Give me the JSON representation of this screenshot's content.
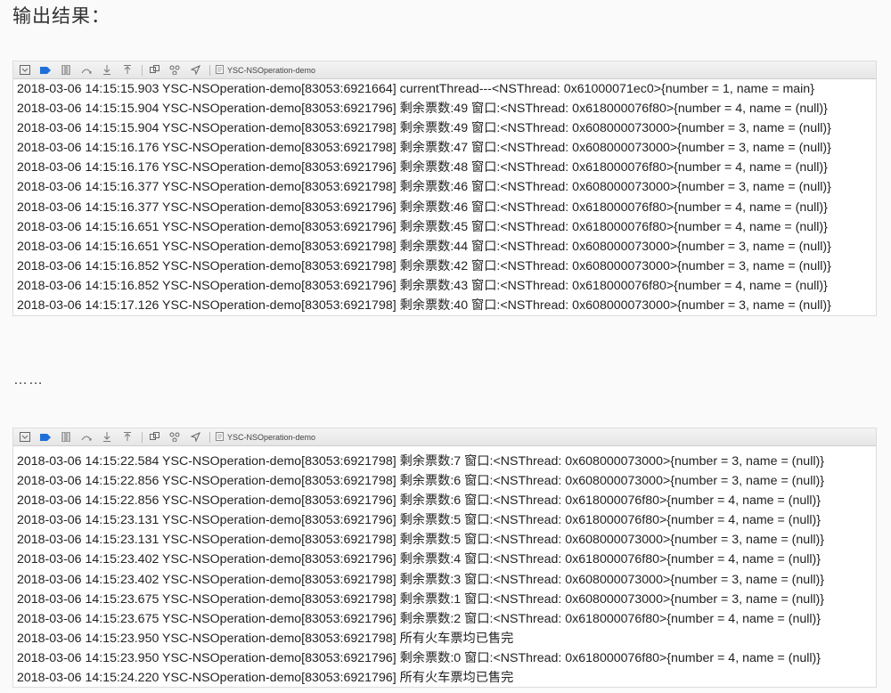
{
  "page": {
    "heading": "输出结果：",
    "ellipsis": "……"
  },
  "panels": [
    {
      "filename": "YSC-NSOperation-demo",
      "lines": [
        "2018-03-06 14:15:15.903 YSC-NSOperation-demo[83053:6921664] currentThread---<NSThread: 0x61000071ec0>{number = 1, name = main}",
        "2018-03-06 14:15:15.904 YSC-NSOperation-demo[83053:6921796] 剩余票数:49 窗口:<NSThread: 0x618000076f80>{number = 4, name = (null)}",
        "2018-03-06 14:15:15.904 YSC-NSOperation-demo[83053:6921798] 剩余票数:49 窗口:<NSThread: 0x608000073000>{number = 3, name = (null)}",
        "2018-03-06 14:15:16.176 YSC-NSOperation-demo[83053:6921798] 剩余票数:47 窗口:<NSThread: 0x608000073000>{number = 3, name = (null)}",
        "2018-03-06 14:15:16.176 YSC-NSOperation-demo[83053:6921796] 剩余票数:48 窗口:<NSThread: 0x618000076f80>{number = 4, name = (null)}",
        "2018-03-06 14:15:16.377 YSC-NSOperation-demo[83053:6921798] 剩余票数:46 窗口:<NSThread: 0x608000073000>{number = 3, name = (null)}",
        "2018-03-06 14:15:16.377 YSC-NSOperation-demo[83053:6921796] 剩余票数:46 窗口:<NSThread: 0x618000076f80>{number = 4, name = (null)}",
        "2018-03-06 14:15:16.651 YSC-NSOperation-demo[83053:6921796] 剩余票数:45 窗口:<NSThread: 0x618000076f80>{number = 4, name = (null)}",
        "2018-03-06 14:15:16.651 YSC-NSOperation-demo[83053:6921798] 剩余票数:44 窗口:<NSThread: 0x608000073000>{number = 3, name = (null)}",
        "2018-03-06 14:15:16.852 YSC-NSOperation-demo[83053:6921798] 剩余票数:42 窗口:<NSThread: 0x608000073000>{number = 3, name = (null)}",
        "2018-03-06 14:15:16.852 YSC-NSOperation-demo[83053:6921796] 剩余票数:43 窗口:<NSThread: 0x618000076f80>{number = 4, name = (null)}",
        "2018-03-06 14:15:17.126 YSC-NSOperation-demo[83053:6921798] 剩余票数:40 窗口:<NSThread: 0x608000073000>{number = 3, name = (null)}"
      ]
    },
    {
      "filename": "YSC-NSOperation-demo",
      "lines": [
        "2018-03-06 14:15:22.584 YSC-NSOperation-demo[83053:6921798] 剩余票数:7 窗口:<NSThread: 0x608000073000>{number = 3, name = (null)}",
        "2018-03-06 14:15:22.856 YSC-NSOperation-demo[83053:6921798] 剩余票数:6 窗口:<NSThread: 0x608000073000>{number = 3, name = (null)}",
        "2018-03-06 14:15:22.856 YSC-NSOperation-demo[83053:6921796] 剩余票数:6 窗口:<NSThread: 0x618000076f80>{number = 4, name = (null)}",
        "2018-03-06 14:15:23.131 YSC-NSOperation-demo[83053:6921796] 剩余票数:5 窗口:<NSThread: 0x618000076f80>{number = 4, name = (null)}",
        "2018-03-06 14:15:23.131 YSC-NSOperation-demo[83053:6921798] 剩余票数:5 窗口:<NSThread: 0x608000073000>{number = 3, name = (null)}",
        "2018-03-06 14:15:23.402 YSC-NSOperation-demo[83053:6921796] 剩余票数:4 窗口:<NSThread: 0x618000076f80>{number = 4, name = (null)}",
        "2018-03-06 14:15:23.402 YSC-NSOperation-demo[83053:6921798] 剩余票数:3 窗口:<NSThread: 0x608000073000>{number = 3, name = (null)}",
        "2018-03-06 14:15:23.675 YSC-NSOperation-demo[83053:6921798] 剩余票数:1 窗口:<NSThread: 0x608000073000>{number = 3, name = (null)}",
        "2018-03-06 14:15:23.675 YSC-NSOperation-demo[83053:6921796] 剩余票数:2 窗口:<NSThread: 0x618000076f80>{number = 4, name = (null)}",
        "2018-03-06 14:15:23.950 YSC-NSOperation-demo[83053:6921798] 所有火车票均已售完",
        "2018-03-06 14:15:23.950 YSC-NSOperation-demo[83053:6921796] 剩余票数:0 窗口:<NSThread: 0x618000076f80>{number = 4, name = (null)}",
        "2018-03-06 14:15:24.220 YSC-NSOperation-demo[83053:6921796] 所有火车票均已售完"
      ]
    }
  ],
  "toolbar_icons": [
    "hide-console-icon",
    "breakpoints-icon",
    "pause-icon",
    "step-over-icon",
    "step-into-icon",
    "step-out-icon",
    "view-hierarchy-icon",
    "memory-graph-icon",
    "location-icon",
    "file-icon"
  ],
  "colors": {
    "breakpoint_blue": "#1e6fd9",
    "toolbar_bg": "#ececec"
  }
}
